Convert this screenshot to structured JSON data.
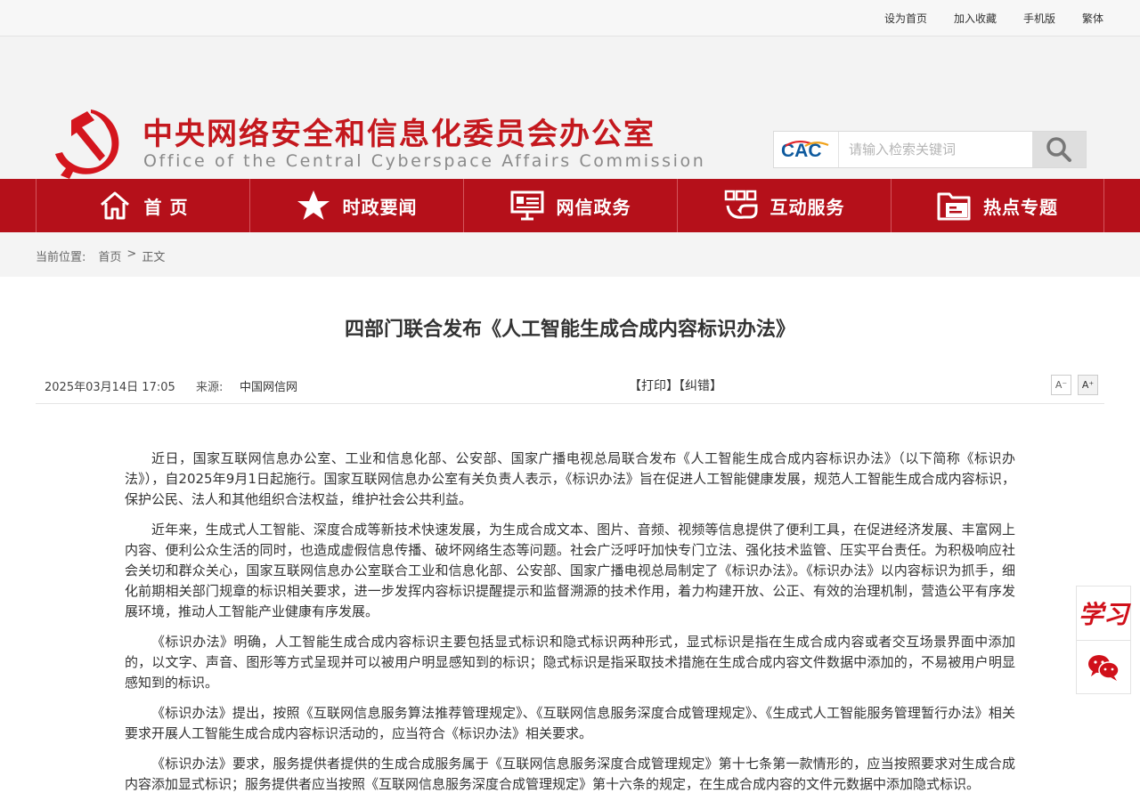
{
  "topbar": {
    "links": [
      "设为首页",
      "加入收藏",
      "手机版",
      "繁体"
    ]
  },
  "header": {
    "title": "中央网络安全和信息化委员会办公室",
    "subtitle": "Office of the Central Cyberspace Affairs Commission",
    "search_logo_text": "CAC",
    "search_placeholder": "请输入检索关键词"
  },
  "nav": {
    "items": [
      {
        "label": "首 页",
        "icon": "home-icon"
      },
      {
        "label": "时政要闻",
        "icon": "star-icon"
      },
      {
        "label": "网信政务",
        "icon": "monitor-icon"
      },
      {
        "label": "互动服务",
        "icon": "interaction-icon"
      },
      {
        "label": "热点专题",
        "icon": "folder-icon"
      }
    ]
  },
  "breadcrumb": {
    "label": "当前位置:",
    "home": "首页",
    "sep": ">",
    "current": "正文"
  },
  "article": {
    "title": "四部门联合发布《人工智能生成合成内容标识办法》",
    "date": "2025年03月14日 17:05",
    "source_label": "来源:",
    "source": "中国网信网",
    "print": "【打印】",
    "correct": "【纠错】",
    "font_smaller": "A⁻",
    "font_larger": "A⁺",
    "paragraphs": [
      "近日，国家互联网信息办公室、工业和信息化部、公安部、国家广播电视总局联合发布《人工智能生成合成内容标识办法》（以下简称《标识办法》），自2025年9月1日起施行。国家互联网信息办公室有关负责人表示，《标识办法》旨在促进人工智能健康发展，规范人工智能生成合成内容标识，保护公民、法人和其他组织合法权益，维护社会公共利益。",
      "近年来，生成式人工智能、深度合成等新技术快速发展，为生成合成文本、图片、音频、视频等信息提供了便利工具，在促进经济发展、丰富网上内容、便利公众生活的同时，也造成虚假信息传播、破坏网络生态等问题。社会广泛呼吁加快专门立法、强化技术监管、压实平台责任。为积极响应社会关切和群众关心，国家互联网信息办公室联合工业和信息化部、公安部、国家广播电视总局制定了《标识办法》。《标识办法》以内容标识为抓手，细化前期相关部门规章的标识相关要求，进一步发挥内容标识提醒提示和监督溯源的技术作用，着力构建开放、公正、有效的治理机制，营造公平有序发展环境，推动人工智能产业健康有序发展。",
      "《标识办法》明确，人工智能生成合成内容标识主要包括显式标识和隐式标识两种形式，显式标识是指在生成合成内容或者交互场景界面中添加的，以文字、声音、图形等方式呈现并可以被用户明显感知到的标识；隐式标识是指采取技术措施在生成合成内容文件数据中添加的，不易被用户明显感知到的标识。",
      "《标识办法》提出，按照《互联网信息服务算法推荐管理规定》、《互联网信息服务深度合成管理规定》、《生成式人工智能服务管理暂行办法》相关要求开展人工智能生成合成内容标识活动的，应当符合《标识办法》相关要求。",
      "《标识办法》要求，服务提供者提供的生成合成服务属于《互联网信息服务深度合成管理规定》第十七条第一款情形的，应当按照要求对生成合成内容添加显式标识；服务提供者应当按照《互联网信息服务深度合成管理规定》第十六条的规定，在生成合成内容的文件元数据中添加隐式标识。"
    ]
  },
  "sidebox": {
    "xuexi_text": "学习",
    "wechat_icon": "wechat-icon"
  },
  "colors": {
    "brand_red": "#b5101a",
    "title_red": "#c4181e"
  }
}
